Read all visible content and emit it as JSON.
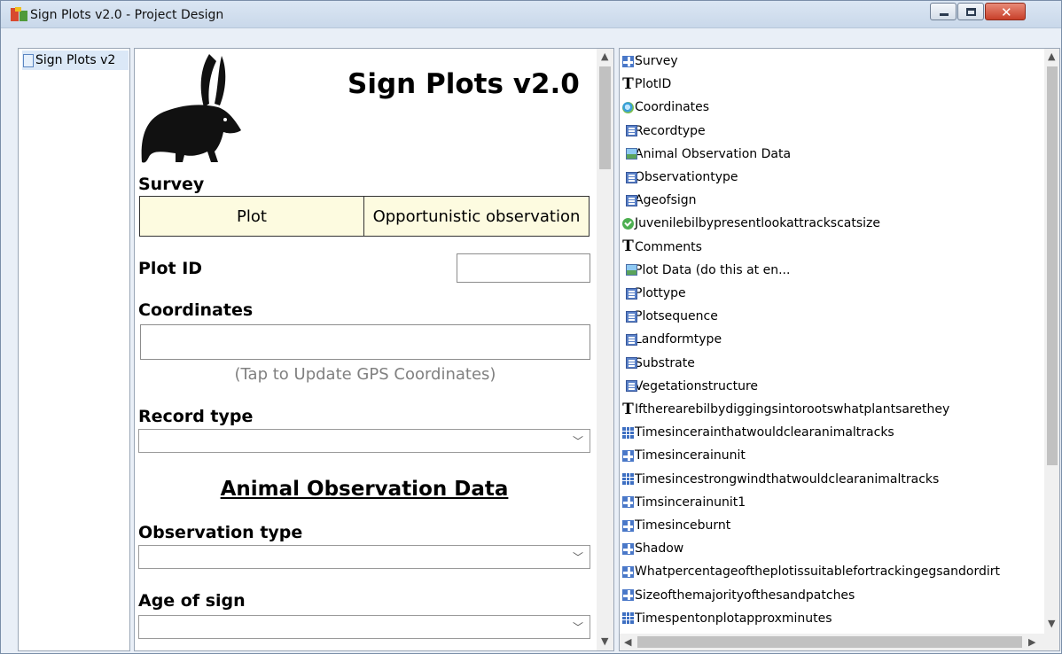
{
  "window": {
    "title": "Sign Plots v2.0 - Project Design",
    "close_glyph": "✕"
  },
  "tree": {
    "items": [
      {
        "label": "Sign Plots v2",
        "icon": "document-icon"
      }
    ]
  },
  "form": {
    "title": "Sign Plots v2.0",
    "survey_label": "Survey",
    "survey_options": [
      "Plot",
      "Opportunistic observation"
    ],
    "plot_id_label": "Plot ID",
    "plot_id_value": "",
    "coordinates_label": "Coordinates",
    "coordinates_value": "",
    "coordinates_hint": "(Tap to Update GPS Coordinates)",
    "record_type_label": "Record type",
    "record_type_value": "",
    "section_animal": "Animal Observation Data",
    "observation_type_label": "Observation type",
    "observation_type_value": "",
    "age_of_sign_label": "Age of sign",
    "age_of_sign_value": ""
  },
  "fields": [
    {
      "icon": "group",
      "label": "Survey"
    },
    {
      "icon": "text",
      "label": "PlotID"
    },
    {
      "icon": "gps",
      "label": "Coordinates"
    },
    {
      "icon": "select",
      "label": "Recordtype"
    },
    {
      "icon": "label",
      "label": "Animal Observation Data"
    },
    {
      "icon": "select",
      "label": "Observationtype"
    },
    {
      "icon": "select",
      "label": "Ageofsign"
    },
    {
      "icon": "yesno",
      "label": "Juvenilebilbypresentlookattrackscatsize"
    },
    {
      "icon": "text",
      "label": "Comments"
    },
    {
      "icon": "label",
      "label": "Plot Data (do this at en..."
    },
    {
      "icon": "select",
      "label": "Plottype"
    },
    {
      "icon": "select",
      "label": "Plotsequence"
    },
    {
      "icon": "select",
      "label": "Landformtype"
    },
    {
      "icon": "select",
      "label": "Substrate"
    },
    {
      "icon": "select",
      "label": "Vegetationstructure"
    },
    {
      "icon": "text",
      "label": "Iftherearebilbydiggingsintorootswhatplantsarethey"
    },
    {
      "icon": "grid",
      "label": "Timesincerainthatwouldclearanimaltracks"
    },
    {
      "icon": "group",
      "label": "Timesincerainunit"
    },
    {
      "icon": "grid",
      "label": "Timesincestrongwindthatwouldclearanimaltracks"
    },
    {
      "icon": "group",
      "label": "Timsincerainunit1"
    },
    {
      "icon": "group",
      "label": "Timesinceburnt"
    },
    {
      "icon": "group",
      "label": "Shadow"
    },
    {
      "icon": "group",
      "label": "Whatpercentageoftheplotissuitablefortrackingegsandordirt"
    },
    {
      "icon": "group",
      "label": "Sizeofthemajorityofthesandpatches"
    },
    {
      "icon": "grid",
      "label": "Timespentonplotapproxminutes"
    }
  ]
}
